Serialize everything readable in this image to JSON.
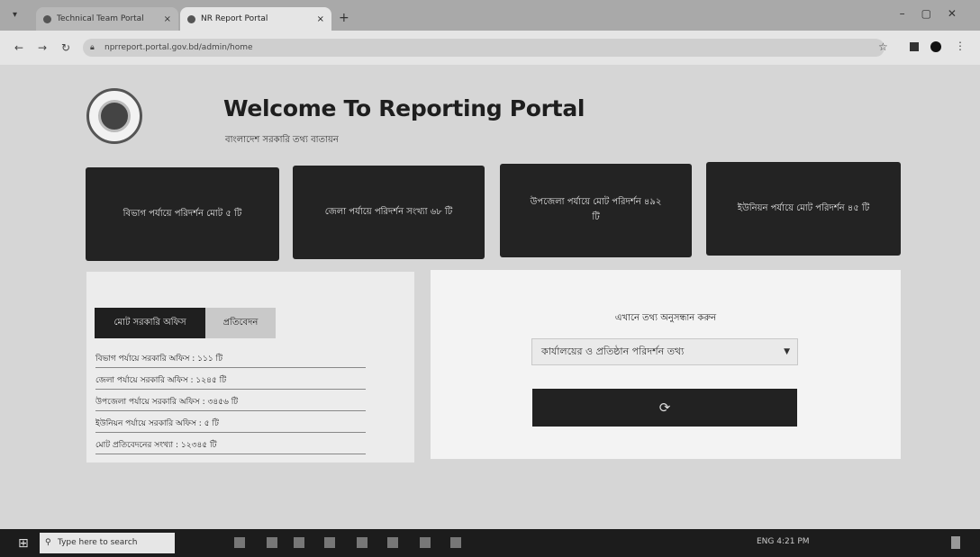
{
  "browser": {
    "tabs": [
      {
        "label": "Technical Team Portal",
        "active": false
      },
      {
        "label": "NR Report Portal",
        "active": true
      }
    ],
    "new_tab": "+",
    "tab_close": "×",
    "url": "nprreport.portal.gov.bd/admin/home"
  },
  "header": {
    "title": "Welcome To Reporting Portal",
    "subtitle": "বাংলাদেশ সরকারি তথ্য বাতায়ন"
  },
  "cards": [
    {
      "label": "বিভাগ পর্যায়ে পরিদর্শন মোট ৫ টি"
    },
    {
      "label": "জেলা পর্যায়ে পরিদর্শন সংখ্যা ৬৮ টি"
    },
    {
      "label": "উপজেলা পর্যায়ে মোট পরিদর্শন ৪৯২ টি"
    },
    {
      "label": "ইউনিয়ন পর্যায়ে মোট পরিদর্শন ৪৫ টি"
    }
  ],
  "stats_panel": {
    "tab_active": "মোট সরকারি অফিস",
    "tab_inactive": "প্রতিবেদন",
    "rows": [
      "বিভাগ পর্যায়ে সরকারি অফিস : ১১১ টি",
      "জেলা পর্যায়ে সরকারি অফিস : ১২৪৫ টি",
      "উপজেলা পর্যায়ে সরকারি অফিস : ৩৪৫৬ টি",
      "ইউনিয়ন পর্যায়ে সরকারি অফিস : ৫ টি",
      "মোট প্রতিবেদনের সংখ্যা : ১২৩৪৫ টি"
    ]
  },
  "report_form": {
    "prompt": "এখানে তথ্য অনুসন্ধান করুন",
    "select_value": "কার্যালয়ের ও প্রতিষ্ঠান পরিদর্শন তথ্য",
    "submit_glyph": "⟳"
  },
  "taskbar": {
    "search_placeholder": "Type here to search",
    "tray_text": "ENG 4:21 PM"
  }
}
